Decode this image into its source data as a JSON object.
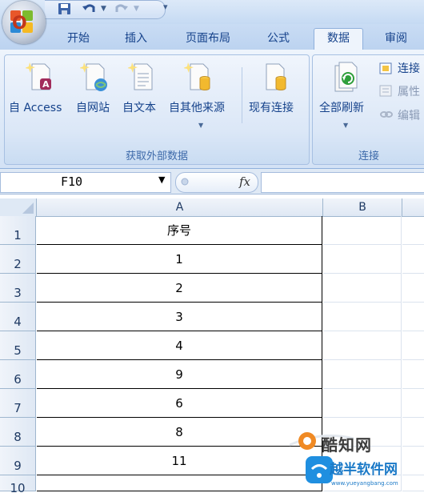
{
  "quick_access": {
    "icons": [
      "save-icon",
      "undo-icon",
      "redo-icon",
      "customize-arrow-icon"
    ]
  },
  "tabs": [
    {
      "label": "开始",
      "active": false
    },
    {
      "label": "插入",
      "active": false
    },
    {
      "label": "页面布局",
      "active": false
    },
    {
      "label": "公式",
      "active": false
    },
    {
      "label": "数据",
      "active": true
    },
    {
      "label": "审阅",
      "active": false
    }
  ],
  "ribbon": {
    "group_external": {
      "label": "获取外部数据",
      "buttons": [
        {
          "label": "自 Access",
          "icon": "access-database-icon"
        },
        {
          "label": "自网站",
          "icon": "web-query-icon"
        },
        {
          "label": "自文本",
          "icon": "text-file-icon"
        },
        {
          "label": "自其他来源",
          "icon": "other-sources-icon"
        },
        {
          "label": "现有连接",
          "icon": "existing-connections-icon"
        }
      ]
    },
    "group_connections": {
      "label": "连接",
      "refresh_label": "全部刷新",
      "small_items": [
        "连接",
        "属性",
        "编辑"
      ]
    }
  },
  "formula_bar": {
    "name_box": "F10",
    "fx": "fx",
    "formula": ""
  },
  "sheet": {
    "columns": [
      "A",
      "B"
    ],
    "rows": [
      "1",
      "2",
      "3",
      "4",
      "5",
      "6",
      "7",
      "8",
      "9",
      "10"
    ],
    "cells_A": [
      "序号",
      "1",
      "2",
      "3",
      "4",
      "9",
      "6",
      "8",
      "11",
      ""
    ]
  },
  "watermark": {
    "title": "酷知网",
    "subtitle": "越半软件网",
    "url": "www.yueyangbang.com"
  },
  "colors": {
    "tab_text": "#15428b",
    "ribbon_bg": "#dde9f8",
    "grid_header": "#dfe8f4"
  }
}
